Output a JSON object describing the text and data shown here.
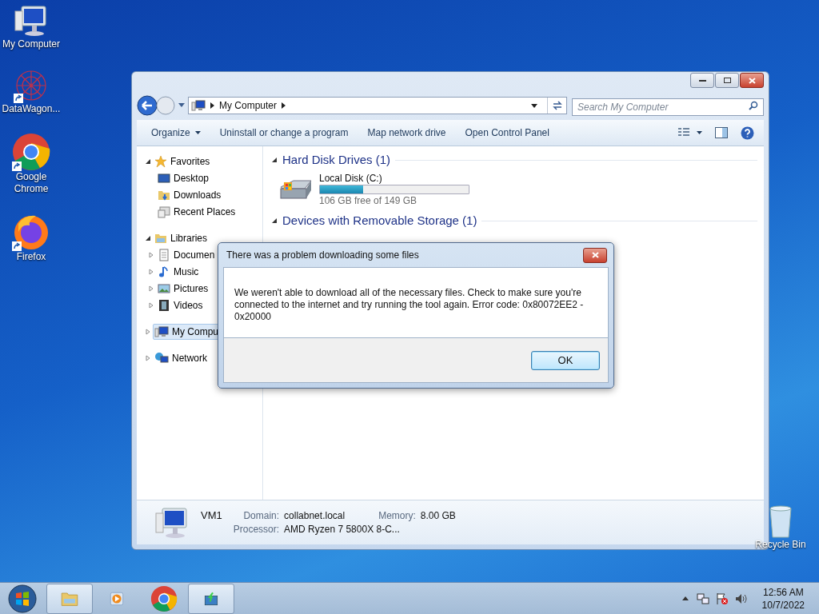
{
  "desktop_icons": [
    {
      "label": "My Computer",
      "kind": "computer",
      "shortcut": false
    },
    {
      "label": "DataWagon...",
      "kind": "datawagon",
      "shortcut": true
    },
    {
      "label": "Google Chrome",
      "kind": "chrome",
      "shortcut": true
    },
    {
      "label": "Firefox",
      "kind": "firefox",
      "shortcut": true
    }
  ],
  "recycle_bin": {
    "label": "Recycle Bin"
  },
  "explorer": {
    "address": "My Computer",
    "search": {
      "placeholder": "Search My Computer"
    },
    "toolbar": [
      {
        "label": "Organize",
        "dropdown": true
      },
      {
        "label": "Uninstall or change a program",
        "dropdown": false
      },
      {
        "label": "Map network drive",
        "dropdown": false
      },
      {
        "label": "Open Control Panel",
        "dropdown": false
      }
    ],
    "nav": [
      {
        "label": "Favorites",
        "kind": "star",
        "expanded": true,
        "selected": false,
        "children": [
          {
            "label": "Desktop",
            "kind": "desktop",
            "selected": false
          },
          {
            "label": "Downloads",
            "kind": "downloads",
            "selected": false
          },
          {
            "label": "Recent Places",
            "kind": "recent",
            "selected": false
          }
        ]
      },
      {
        "label": "Libraries",
        "kind": "libraries",
        "expanded": true,
        "selected": false,
        "children": [
          {
            "label": "Documen",
            "kind": "documents",
            "expanded": false,
            "selected": false
          },
          {
            "label": "Music",
            "kind": "music",
            "expanded": false,
            "selected": false
          },
          {
            "label": "Pictures",
            "kind": "pictures",
            "expanded": false,
            "selected": false
          },
          {
            "label": "Videos",
            "kind": "videos",
            "expanded": false,
            "selected": false
          }
        ]
      },
      {
        "label": "My Compu",
        "kind": "computer",
        "expanded": false,
        "selected": true
      },
      {
        "label": "Network",
        "kind": "network",
        "expanded": false,
        "selected": false
      }
    ],
    "groups": [
      {
        "title": "Hard Disk Drives (1)",
        "expanded": true,
        "drives": [
          {
            "name": "Local Disk (C:)",
            "level": 0.29,
            "free": "106 GB free of 149 GB"
          }
        ]
      },
      {
        "title": "Devices with Removable Storage (1)",
        "expanded": true
      }
    ],
    "details": {
      "name": "VM1",
      "fields": [
        {
          "label": "Domain:",
          "value": "collabnet.local"
        },
        {
          "label": "Memory:",
          "value": "8.00 GB"
        },
        {
          "label": "Processor:",
          "value": "AMD Ryzen 7 5800X 8-C..."
        }
      ]
    }
  },
  "dialog": {
    "title": "There was a problem downloading some files",
    "message": "We weren't able to download all of the necessary files. Check to make sure you're connected to the internet and try running the tool again. Error code: 0x80072EE2 - 0x20000",
    "button": "OK"
  },
  "taskbar": {
    "items": [
      {
        "kind": "explorer",
        "active": true
      },
      {
        "kind": "media",
        "active": false
      },
      {
        "kind": "chrome",
        "active": false
      },
      {
        "kind": "installer",
        "active": true
      }
    ],
    "time": "12:56 AM",
    "date": "10/7/2022"
  }
}
